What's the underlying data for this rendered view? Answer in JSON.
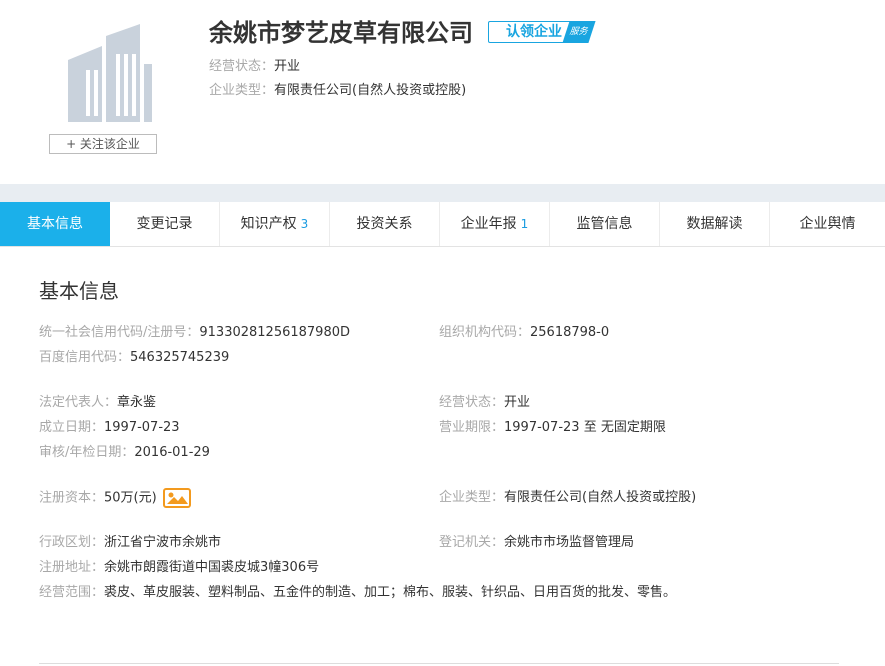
{
  "company": {
    "name": "余姚市梦艺皮草有限公司",
    "badge": "认领企业",
    "badge_tag": "服务",
    "follow_label": "+ 关注该企业",
    "status_label": "经营状态：",
    "status_value": "开业",
    "type_label": "企业类型：",
    "type_value": "有限责任公司(自然人投资或控股)"
  },
  "tabs": [
    {
      "label": "基本信息",
      "count": ""
    },
    {
      "label": "变更记录",
      "count": ""
    },
    {
      "label": "知识产权",
      "count": "3"
    },
    {
      "label": "投资关系",
      "count": ""
    },
    {
      "label": "企业年报",
      "count": "1"
    },
    {
      "label": "监管信息",
      "count": ""
    },
    {
      "label": "数据解读",
      "count": ""
    },
    {
      "label": "企业舆情",
      "count": ""
    }
  ],
  "basic": {
    "title": "基本信息",
    "credit_code_label": "统一社会信用代码/注册号：",
    "credit_code": "91330281256187980D",
    "org_code_label": "组织机构代码：",
    "org_code": "25618798-0",
    "baidu_code_label": "百度信用代码：",
    "baidu_code": "546325745239",
    "legal_rep_label": "法定代表人：",
    "legal_rep": "章永鉴",
    "status_label": "经营状态：",
    "status": "开业",
    "founded_label": "成立日期：",
    "founded": "1997-07-23",
    "term_label": "营业期限：",
    "term": "1997-07-23 至 无固定期限",
    "audit_label": "审核/年检日期：",
    "audit": "2016-01-29",
    "capital_label": "注册资本：",
    "capital": "50万(元)",
    "type_label": "企业类型：",
    "type": "有限责任公司(自然人投资或控股)",
    "region_label": "行政区划：",
    "region": "浙江省宁波市余姚市",
    "authority_label": "登记机关：",
    "authority": "余姚市市场监督管理局",
    "address_label": "注册地址：",
    "address": "余姚市朗霞街道中国裘皮城3幢306号",
    "scope_label": "经营范围：",
    "scope": "裘皮、革皮服装、塑料制品、五金件的制造、加工；棉布、服装、针织品、日用百货的批发、零售。"
  },
  "colors": {
    "accent": "#1bb0ea",
    "badge": "#19a5e0",
    "label": "#a8a8a8",
    "text": "#333333",
    "band": "#e8edf2"
  },
  "icons": {
    "logo": "building-icon",
    "capital": "money-image-icon"
  }
}
